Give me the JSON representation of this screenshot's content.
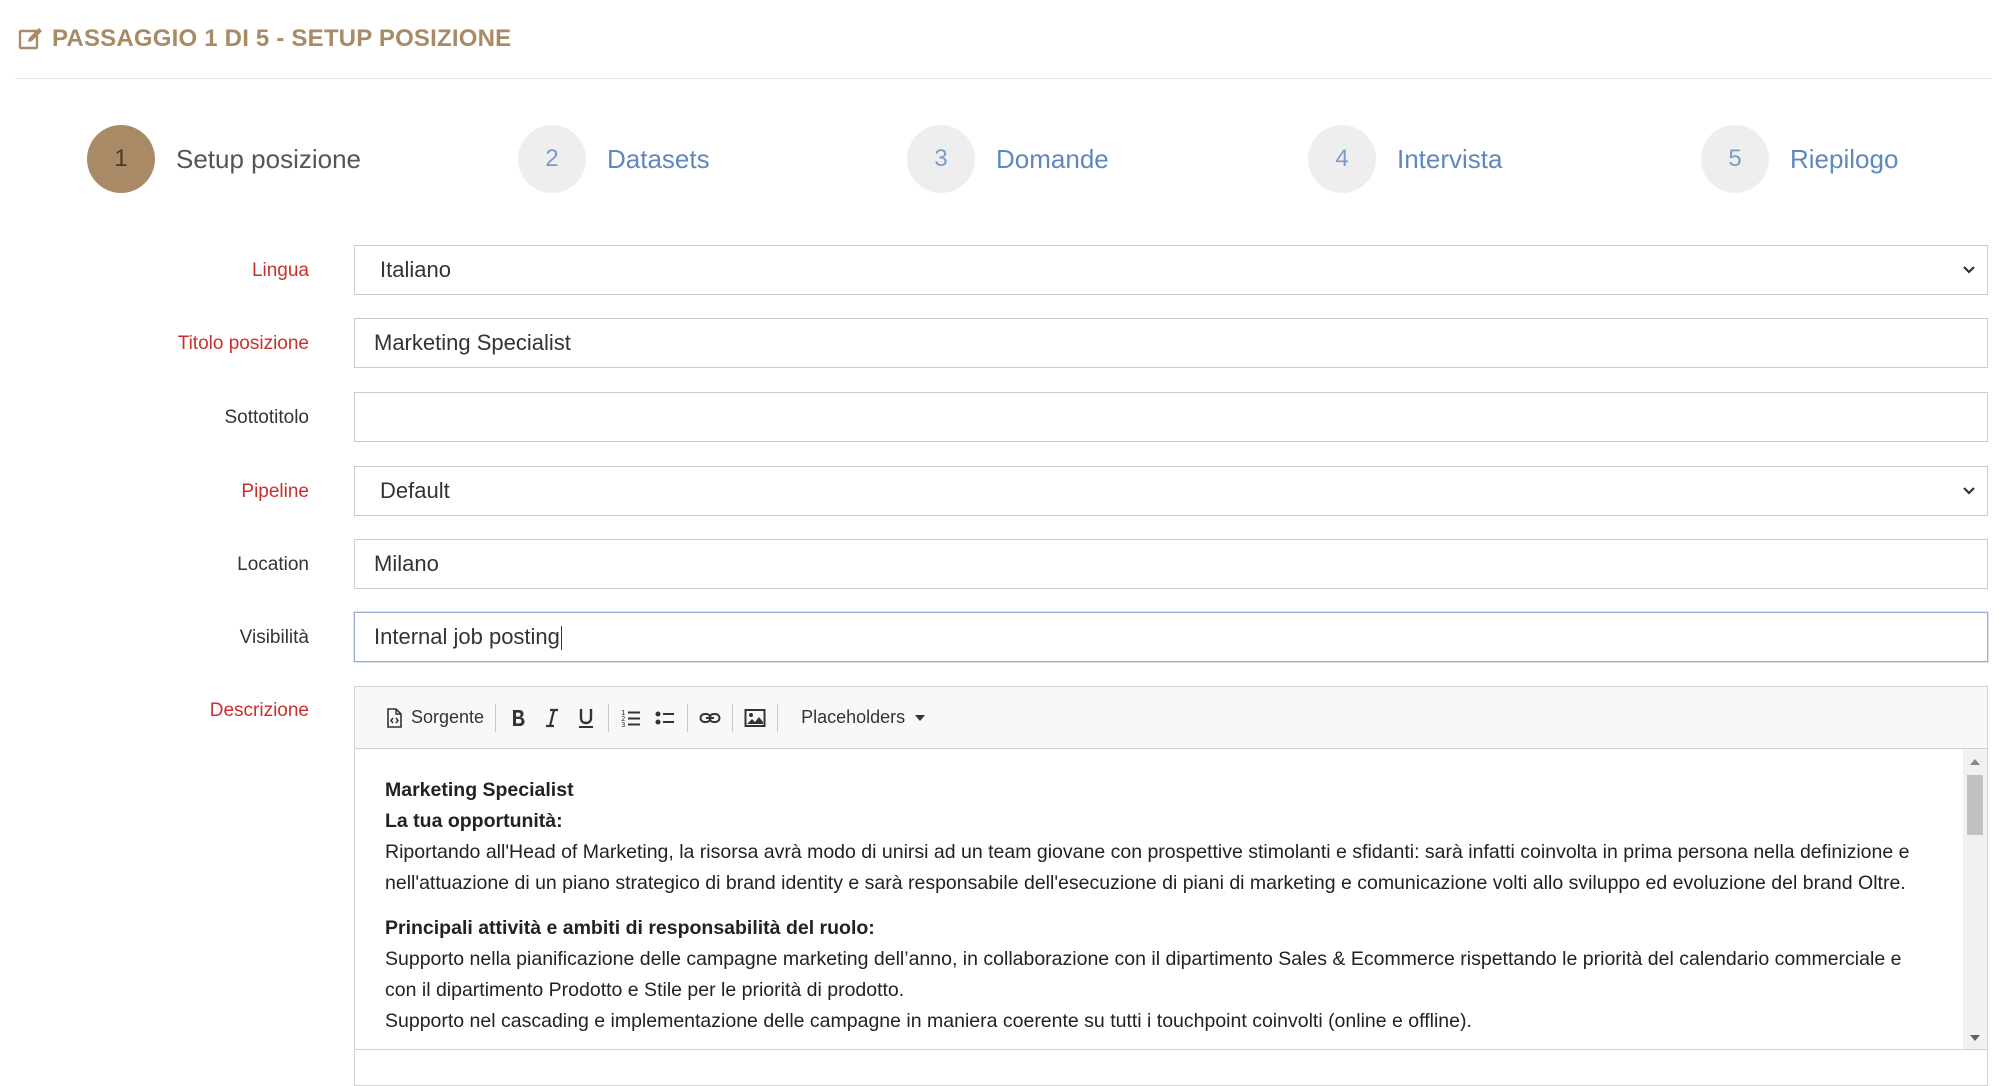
{
  "header": {
    "title": "PASSAGGIO 1 DI 5 - SETUP POSIZIONE",
    "icon": "edit-icon",
    "color": "#a88b66"
  },
  "steps": [
    {
      "number": "1",
      "label": "Setup posizione",
      "active": true
    },
    {
      "number": "2",
      "label": "Datasets",
      "active": false
    },
    {
      "number": "3",
      "label": "Domande",
      "active": false
    },
    {
      "number": "4",
      "label": "Intervista",
      "active": false
    },
    {
      "number": "5",
      "label": "Riepilogo",
      "active": false
    }
  ],
  "form": {
    "lingua": {
      "label": "Lingua",
      "value": "Italiano",
      "required": true
    },
    "titolo": {
      "label": "Titolo posizione",
      "value": "Marketing Specialist",
      "required": true
    },
    "sottotitolo": {
      "label": "Sottotitolo",
      "value": "",
      "required": false
    },
    "pipeline": {
      "label": "Pipeline",
      "value": "Default",
      "required": true
    },
    "location": {
      "label": "Location",
      "value": "Milano",
      "required": false
    },
    "visibilita": {
      "label": "Visibilità",
      "value": "Internal job posting",
      "required": false
    },
    "descrizione": {
      "label": "Descrizione",
      "required": true
    }
  },
  "editor": {
    "toolbar": {
      "source_label": "Sorgente",
      "placeholders_label": "Placeholders",
      "icons": [
        "source-icon",
        "bold-icon",
        "italic-icon",
        "underline-icon",
        "numbered-list-icon",
        "bullet-list-icon",
        "link-icon",
        "image-icon"
      ]
    },
    "content": {
      "title": "Marketing Specialist",
      "opportunity_heading": "La tua opportunità:",
      "opportunity_text": "Riportando all'Head of Marketing, la risorsa avrà modo di unirsi ad un team giovane con prospettive stimolanti e sfidanti: sarà infatti coinvolta in prima persona nella definizione e nell'attuazione di un piano strategico di brand identity e sarà responsabile dell'esecuzione di piani di marketing e comunicazione volti allo sviluppo ed evoluzione del brand Oltre.",
      "activities_heading": "Principali attività e ambiti di responsabilità del ruolo:",
      "activity_1": "Supporto nella pianificazione delle campagne marketing dell’anno, in collaborazione con il dipartimento Sales & Ecommerce rispettando le priorità del calendario commerciale e con il dipartimento Prodotto e Stile per le priorità di prodotto.",
      "activity_2": "Supporto nel cascading e implementazione delle campagne in maniera coerente su tutti i touchpoint coinvolti (online e offline)."
    }
  },
  "colors": {
    "accent": "#a88b66",
    "link": "#5f88bf",
    "required": "#c9302c"
  }
}
